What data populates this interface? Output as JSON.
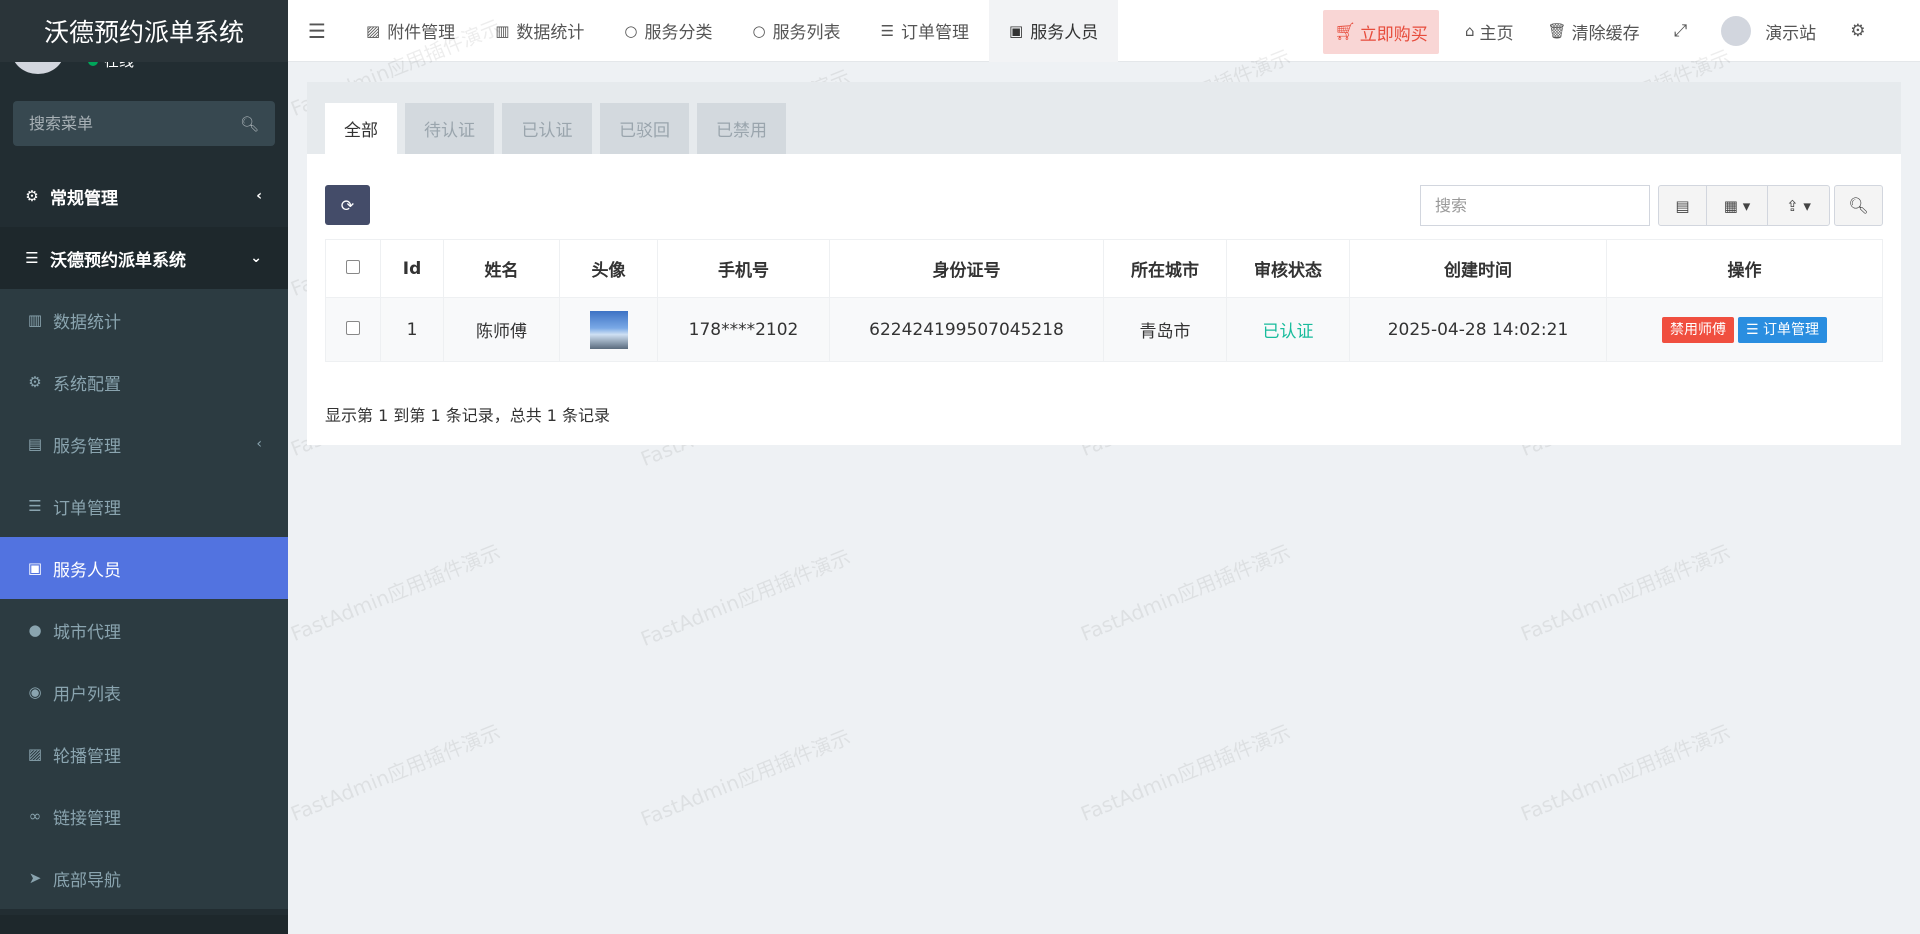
{
  "app": {
    "title": "沃德预约派单系统",
    "user_status": "在线",
    "search_placeholder": "搜索菜单"
  },
  "menu": [
    {
      "label": "常规管理",
      "icon": "cogs-icon"
    },
    {
      "label": "沃德预约派单系统",
      "icon": "list-icon"
    },
    {
      "label": "数据统计",
      "icon": "bar-chart-icon"
    },
    {
      "label": "系统配置",
      "icon": "gear-icon"
    },
    {
      "label": "服务管理",
      "icon": "server-icon"
    },
    {
      "label": "订单管理",
      "icon": "list-icon"
    },
    {
      "label": "服务人员",
      "icon": "id-card-icon"
    },
    {
      "label": "城市代理",
      "icon": "user-times-icon"
    },
    {
      "label": "用户列表",
      "icon": "user-circle-icon"
    },
    {
      "label": "轮播管理",
      "icon": "image-icon"
    },
    {
      "label": "链接管理",
      "icon": "link-icon"
    },
    {
      "label": "底部导航",
      "icon": "paper-plane-icon"
    }
  ],
  "topnav": {
    "tabs": [
      {
        "label": "附件管理",
        "icon": "image-icon"
      },
      {
        "label": "数据统计",
        "icon": "bar-chart-icon"
      },
      {
        "label": "服务分类",
        "icon": "circle-icon"
      },
      {
        "label": "服务列表",
        "icon": "circle-icon"
      },
      {
        "label": "订单管理",
        "icon": "list-icon"
      },
      {
        "label": "服务人员",
        "icon": "id-card-icon"
      }
    ],
    "buy_label": "立即购买",
    "home_label": "主页",
    "clear_cache_label": "清除缓存",
    "user_label": "演示站"
  },
  "watermark_text": "FastAdmin应用插件演示",
  "panel": {
    "tabs": [
      "全部",
      "待认证",
      "已认证",
      "已驳回",
      "已禁用"
    ],
    "search_placeholder": "搜索"
  },
  "table": {
    "columns": [
      "Id",
      "姓名",
      "头像",
      "手机号",
      "身份证号",
      "所在城市",
      "审核状态",
      "创建时间",
      "操作"
    ],
    "rows": [
      {
        "id": "1",
        "name": "陈师傅",
        "phone": "178****2102",
        "id_card": "622424199507045218",
        "city": "青岛市",
        "status": "已认证",
        "created": "2025-04-28 14:02:21",
        "btn_disable": "禁用师傅",
        "btn_orders": "订单管理"
      }
    ]
  },
  "footer_text": "显示第 1 到第 1 条记录，总共 1 条记录",
  "colors": {
    "sidebar_bg": "#222d32",
    "active_menu": "#5273e0",
    "refresh_btn": "#444c69",
    "status_ok": "#18bc9c",
    "btn_red": "#f04f3f",
    "btn_blue": "#2a8ee0"
  }
}
